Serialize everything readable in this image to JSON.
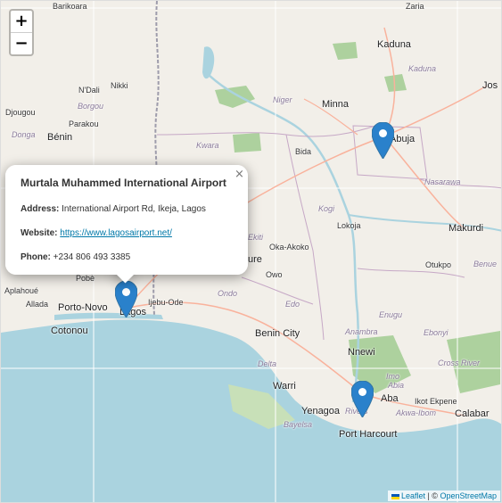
{
  "zoom": {
    "in_label": "+",
    "out_label": "−"
  },
  "places": {
    "zaria": "Zaria",
    "barikoara": "Barikoara",
    "kaduna_city": "Kaduna",
    "kaduna_region": "Kaduna",
    "jos": "Jos",
    "ndali": "N'Dali",
    "nikki": "Nikki",
    "borgou": "Borgou",
    "djougou": "Djougou",
    "parakou": "Parakou",
    "donga": "Donga",
    "benin_country": "Bénin",
    "minna": "Minna",
    "niger": "Niger",
    "abuja": "Abuja",
    "bida": "Bida",
    "kwara": "Kwara",
    "nasarawa": "Nasarawa",
    "lokoja": "Lokoja",
    "makurdi": "Makurdi",
    "ekiti": "Ekiti",
    "oka_akoko": "Oka-Akoko",
    "otukpo": "Otukpo",
    "benue": "Benue",
    "kogi": "Kogi",
    "owo": "Owo",
    "ondo": "Ondo",
    "edo": "Edo",
    "enugu": "Enugu",
    "aplahoue": "Aplahoué",
    "allada": "Allada",
    "porto_novo": "Porto-Novo",
    "cotonou": "Cotonou",
    "pobe": "Pobè",
    "lagos": "Lagos",
    "ijebu_ode": "Ijebu-Ode",
    "benin_city": "Benin City",
    "anambra": "Anambra",
    "ebonyi": "Ebonyi",
    "nnewi": "Nnewi",
    "delta": "Delta",
    "cross_river": "Cross River",
    "warri": "Warri",
    "imo": "Imo",
    "abia": "Abia",
    "aba": "Aba",
    "ikot_ekpene": "Ikot Ekpene",
    "akwa_ibom": "Akwa-Ibom",
    "calabar": "Calabar",
    "yenagoa": "Yenagoa",
    "rivers": "Rivers",
    "bayelsa": "Bayelsa",
    "port_harcourt": "Port Harcourt",
    "ure": "ure"
  },
  "popup": {
    "title": "Murtala Muhammed International Airport",
    "address_label": "Address:",
    "address": "International Airport Rd, Ikeja, Lagos",
    "website_label": "Website:",
    "website": "https://www.lagosairport.net/",
    "phone_label": "Phone:",
    "phone": "+234 806 493 3385",
    "close": "×"
  },
  "markers": [
    "Lagos",
    "Abuja",
    "Port Harcourt"
  ],
  "attribution": {
    "leaflet": "Leaflet",
    "sep": " | © ",
    "osm": "OpenStreetMap"
  },
  "colors": {
    "water": "#aad3df",
    "land": "#f2efe9",
    "forest": "#add19e",
    "marker": "#2a81cb",
    "border": "#9e9cab"
  }
}
